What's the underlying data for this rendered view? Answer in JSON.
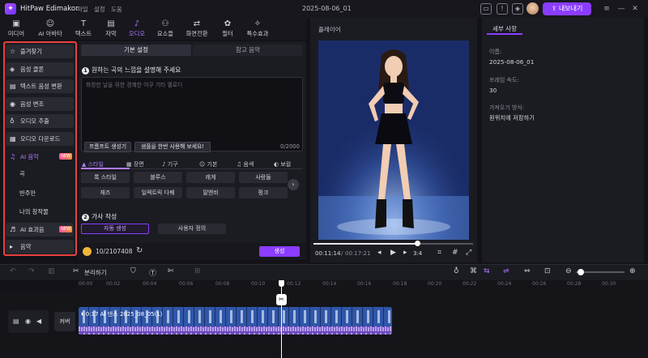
{
  "titlebar": {
    "app_name": "HitPaw Edimakor",
    "menu": [
      "파일",
      "설정",
      "도움"
    ],
    "project_title": "2025-08-06_01",
    "export_label": "내보내기"
  },
  "toolbar": {
    "tools": [
      {
        "label": "미디어",
        "icon": "media-icon"
      },
      {
        "label": "AI 아바타",
        "icon": "avatar-icon"
      },
      {
        "label": "텍스트",
        "icon": "text-icon"
      },
      {
        "label": "자막",
        "icon": "subtitle-icon"
      },
      {
        "label": "오디오",
        "icon": "audio-icon"
      },
      {
        "label": "요소들",
        "icon": "elements-icon"
      },
      {
        "label": "화면전환",
        "icon": "transition-icon"
      },
      {
        "label": "필터",
        "icon": "filter-icon"
      },
      {
        "label": "특수효과",
        "icon": "effects-icon"
      }
    ]
  },
  "sidebar": {
    "items": [
      {
        "label": "즐겨찾기",
        "icon": "star-icon"
      },
      {
        "label": "음성 클론",
        "icon": "voice-clone-icon"
      },
      {
        "label": "텍스트 음성 변환",
        "icon": "tts-icon"
      },
      {
        "label": "음성 변조",
        "icon": "voice-changer-icon"
      },
      {
        "label": "오디오 추출",
        "icon": "mic-icon"
      },
      {
        "label": "오디오 다운로드",
        "icon": "download-icon"
      },
      {
        "label": "AI 음악",
        "icon": "music-icon",
        "badge": "NEW"
      }
    ],
    "sub_items": [
      "곡",
      "반주만",
      "나의 창작물"
    ],
    "bottom_items": [
      {
        "label": "AI 효과음",
        "icon": "sfx-icon",
        "badge": "NEW"
      },
      {
        "label": "음악",
        "icon": "caret-right-icon"
      }
    ]
  },
  "main": {
    "tabs": [
      "기본 설정",
      "참고 음악"
    ],
    "section1_title": "원하는 곡의 느낌을 설명해 주세요",
    "section1_num": "1",
    "prompt_placeholder": "화창한 날을 위한 경쾌한 어쿠 기타 멜로디",
    "prompt_generator": "프롬프트 생성기",
    "try_sample": "샘플을 한번 사용해 보세요!",
    "counter": "0/2000",
    "categories": [
      "스타일",
      "장면",
      "기구",
      "기본",
      "음색",
      "보컬"
    ],
    "chips": [
      "록 스타일",
      "블루스",
      "레게",
      "사랑들",
      "재즈",
      "일렉트릭 다퀘",
      "말엔비",
      "펑크"
    ],
    "section2_title": "가사 작성",
    "section2_num": "2",
    "auto_generate": "자동 생성",
    "custom": "사용자 정의",
    "credit": "10/2107408",
    "generate": "생성"
  },
  "player": {
    "title": "플레이어",
    "current_time": "00:11:14",
    "total_time": "00:17:21",
    "speed": "3:4",
    "progress": 0.65
  },
  "details": {
    "tab": "세부 사항",
    "name_label": "이름:",
    "name_value": "2025-08-06_01",
    "fps_label": "프레임 속도:",
    "fps_value": "30",
    "import_label": "가져오기 방식:",
    "import_value": "원위치에 저장하기"
  },
  "timeline": {
    "split_label": "분리하기",
    "ticks": [
      "00:00",
      "00:02",
      "00:04",
      "00:06",
      "00:08",
      "00:10",
      "00:12",
      "00:14",
      "00:16",
      "00:18",
      "00:20",
      "00:22",
      "00:24",
      "00:26",
      "00:28",
      "00:30"
    ],
    "cover_label": "커버",
    "clip_label": "0:17 AI 댄스 2025_08_05(1)"
  }
}
